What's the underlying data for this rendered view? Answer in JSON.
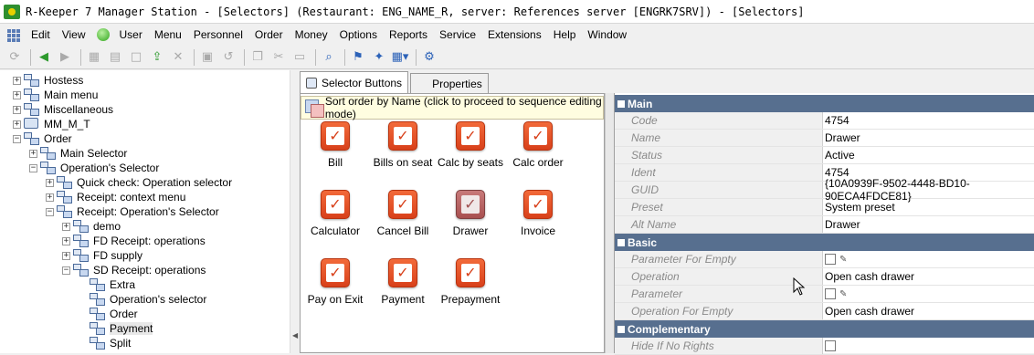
{
  "window": {
    "title": "R-Keeper 7 Manager Station - [Selectors] (Restaurant: ENG_NAME_R, server: References server [ENGRK7SRV]) - [Selectors]"
  },
  "menu": {
    "items": [
      "Edit",
      "View",
      "User",
      "Menu",
      "Personnel",
      "Order",
      "Money",
      "Options",
      "Reports",
      "Service",
      "Extensions",
      "Help",
      "Window"
    ]
  },
  "toolbar": {
    "icons": [
      "refresh-icon",
      "back-icon",
      "forward-icon",
      "grid-icon",
      "layout-icon",
      "new-icon",
      "export-icon",
      "delete-icon",
      "save-icon",
      "undo-icon",
      "copy-icon",
      "cut-icon",
      "paste-icon",
      "find-icon",
      "filter-icon",
      "tools-icon",
      "view-icon",
      "gear-icon"
    ]
  },
  "tree": {
    "nodes": [
      {
        "label": "Hostess",
        "level": 0,
        "expander": "+"
      },
      {
        "label": "Main menu",
        "level": 0,
        "expander": "+"
      },
      {
        "label": "Miscellaneous",
        "level": 0,
        "expander": "+"
      },
      {
        "label": "MM_M_T",
        "level": 0,
        "expander": "+"
      },
      {
        "label": "Order",
        "level": 0,
        "expander": "−"
      },
      {
        "label": "Main Selector",
        "level": 1,
        "expander": "+"
      },
      {
        "label": "Operation's Selector",
        "level": 1,
        "expander": "−"
      },
      {
        "label": "Quick check: Operation selector",
        "level": 2,
        "expander": "+"
      },
      {
        "label": "Receipt: context menu",
        "level": 2,
        "expander": "+"
      },
      {
        "label": "Receipt: Operation's Selector",
        "level": 2,
        "expander": "−"
      },
      {
        "label": "demo",
        "level": 3,
        "expander": "+"
      },
      {
        "label": "FD Receipt: operations",
        "level": 3,
        "expander": "+"
      },
      {
        "label": "FD supply",
        "level": 3,
        "expander": "+"
      },
      {
        "label": "SD Receipt: operations",
        "level": 3,
        "expander": "−"
      },
      {
        "label": "Extra",
        "level": 4,
        "expander": ""
      },
      {
        "label": "Operation's selector",
        "level": 4,
        "expander": ""
      },
      {
        "label": "Order",
        "level": 4,
        "expander": ""
      },
      {
        "label": "Payment",
        "level": 4,
        "expander": "",
        "selected": true
      },
      {
        "label": "Split",
        "level": 4,
        "expander": ""
      }
    ]
  },
  "tabs": {
    "selector_buttons": "Selector Buttons",
    "properties": "Properties"
  },
  "sortbar": {
    "text": "Sort order by Name (click to proceed to sequence editing mode)"
  },
  "buttons": [
    {
      "label": "Bill",
      "pressed": false
    },
    {
      "label": "Bills on seat",
      "pressed": false
    },
    {
      "label": "Calc by seats",
      "pressed": false
    },
    {
      "label": "Calc order",
      "pressed": false
    },
    {
      "label": "Calculator",
      "pressed": false
    },
    {
      "label": "Cancel Bill",
      "pressed": false
    },
    {
      "label": "Drawer",
      "pressed": true
    },
    {
      "label": "Invoice",
      "pressed": false
    },
    {
      "label": "Pay on Exit",
      "pressed": false
    },
    {
      "label": "Payment",
      "pressed": false
    },
    {
      "label": "Prepayment",
      "pressed": false
    }
  ],
  "properties": {
    "main_header": "Main",
    "basic_header": "Basic",
    "complementary_header": "Complementary",
    "main": [
      {
        "key": "Code",
        "value": "4754"
      },
      {
        "key": "Name",
        "value": "Drawer"
      },
      {
        "key": "Status",
        "value": "Active"
      },
      {
        "key": "Ident",
        "value": "4754"
      },
      {
        "key": "GUID",
        "value": "{10A0939F-9502-4448-BD10-90ECA4FDCE81}"
      },
      {
        "key": "Preset",
        "value": "System preset"
      },
      {
        "key": "Alt Name",
        "value": "Drawer"
      }
    ],
    "basic": [
      {
        "key": "Parameter For Empty",
        "value": "",
        "checkbox": true
      },
      {
        "key": "Operation",
        "value": "Open cash drawer"
      },
      {
        "key": "Parameter",
        "value": "",
        "checkbox": true
      },
      {
        "key": "Operation For Empty",
        "value": "Open cash drawer"
      }
    ],
    "complementary": [
      {
        "key": "Hide If No Rights",
        "value": "",
        "checkbox": true,
        "nopencil": true
      }
    ]
  },
  "colors": {
    "section_header": "#576f8f",
    "button_red": "#e4532a"
  }
}
